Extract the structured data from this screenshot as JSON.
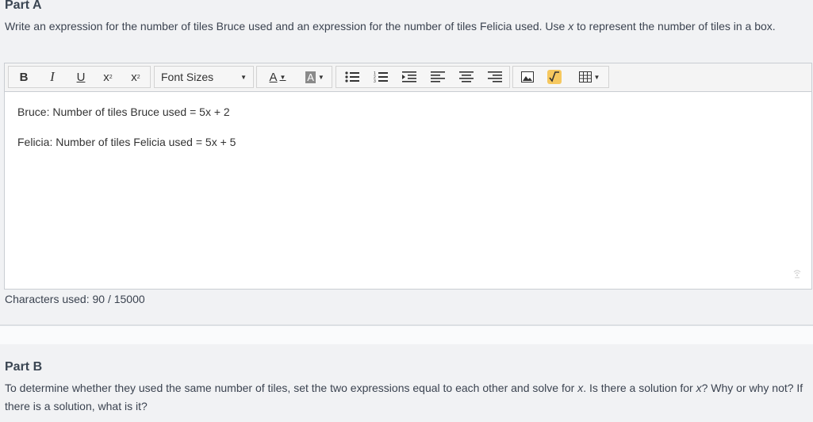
{
  "partA": {
    "title": "Part A",
    "prompt_1": "Write an expression for the number of tiles Bruce used and an expression for the number of tiles Felicia used. Use ",
    "prompt_var": "x",
    "prompt_2": " to represent the number of tiles in a box."
  },
  "toolbar": {
    "bold": "B",
    "italic": "I",
    "underline": "U",
    "superscript": "x",
    "subscript": "x",
    "font_sizes": "Font Sizes",
    "font_color": "A",
    "bg_color": "A"
  },
  "editor": {
    "line1": "Bruce: Number of tiles Bruce used = 5x + 2",
    "line2": "Felicia: Number of tiles Felicia used = 5x + 5"
  },
  "char_count": "Characters used: 90 / 15000",
  "partB": {
    "title": "Part B",
    "prompt_1": "To determine whether they used the same number of tiles, set the two expressions equal to each other and solve for ",
    "var1": "x",
    "prompt_2": ". Is there a solution for ",
    "var2": "x",
    "prompt_3": "? Why or why not? If there is a solution, what is it?"
  },
  "icons": [
    "bold-icon",
    "italic-icon",
    "underline-icon",
    "superscript-icon",
    "subscript-icon",
    "font-color-icon",
    "background-color-icon",
    "bulleted-list-icon",
    "numbered-list-icon",
    "indent-icon",
    "align-left-icon",
    "align-center-icon",
    "align-right-icon",
    "image-icon",
    "equation-icon",
    "table-icon",
    "resize-handle-icon"
  ],
  "colors": {
    "equation_icon_bg": "#f6c85f",
    "background": "#f1f2f4"
  }
}
